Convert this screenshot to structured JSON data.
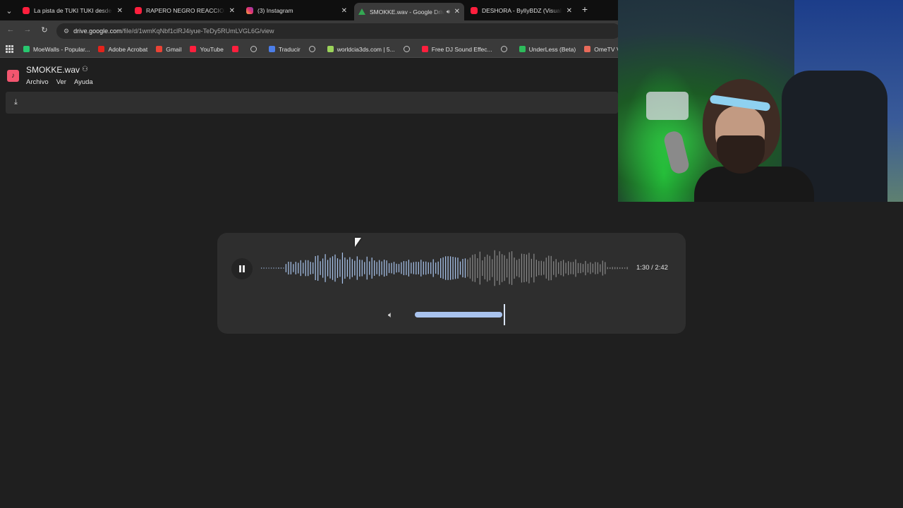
{
  "browser": {
    "tabs": [
      {
        "title": "La pista de TUKI TUKI desde ce",
        "favicon": "youtube-icon",
        "active": false
      },
      {
        "title": "RAPERO NEGRO REACCIONA A",
        "favicon": "youtube-icon",
        "active": false
      },
      {
        "title": "(3) Instagram",
        "favicon": "instagram-icon",
        "active": false
      },
      {
        "title": "SMOKKE.wav - Google Drive",
        "favicon": "google-drive-icon",
        "active": true,
        "audio": true
      },
      {
        "title": "DESHORA - BylIyBDZ (Visualizer",
        "favicon": "youtube-icon",
        "active": false
      }
    ],
    "url_host": "drive.google.com",
    "url_path": "/file/d/1wmKqNbf1clRJ4iyue-TeDy5RUmLVGL6G/view",
    "bookmarks": [
      {
        "label": "MoeWalls - Popular...",
        "icon": "moewalls-icon"
      },
      {
        "label": "Adobe Acrobat",
        "icon": "adobe-icon"
      },
      {
        "label": "Gmail",
        "icon": "gmail-icon"
      },
      {
        "label": "YouTube",
        "icon": "youtube-icon"
      },
      {
        "label": "",
        "icon": "youtube-icon"
      },
      {
        "label": "",
        "icon": "globe-icon"
      },
      {
        "label": "Traducir",
        "icon": "translate-icon"
      },
      {
        "label": "",
        "icon": "globe-icon"
      },
      {
        "label": "worldcia3ds.com | 5...",
        "icon": "worldcia-icon"
      },
      {
        "label": "",
        "icon": "globe-icon"
      },
      {
        "label": "Free DJ Sound Effec...",
        "icon": "youtube-icon"
      },
      {
        "label": "",
        "icon": "globe-icon"
      },
      {
        "label": "UnderLess (Beta)",
        "icon": "underless-icon"
      },
      {
        "label": "OmeTV Video Chat...",
        "icon": "ometv-icon"
      }
    ]
  },
  "viewer": {
    "file_name": "SMOKKE.wav",
    "menu": [
      "Archivo",
      "Ver",
      "Ayuda"
    ]
  },
  "player": {
    "state": "playing",
    "current_time": "1:30",
    "duration": "2:42",
    "progress": 0.556,
    "volume": 1.0,
    "colors": {
      "played": "#aac6ef",
      "unplayed": "#8a8a8a",
      "volume_fill": "#a9c3ee",
      "volume_track": "#4a5a78"
    }
  }
}
